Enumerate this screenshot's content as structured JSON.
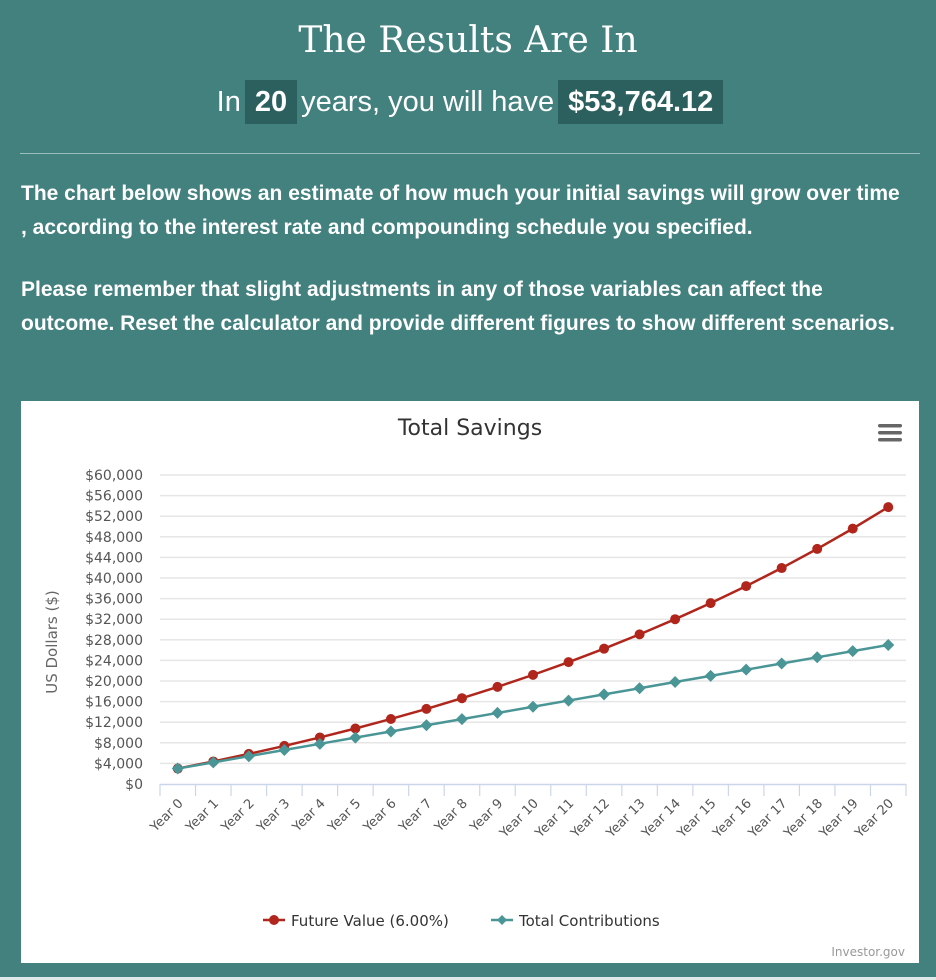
{
  "header": {
    "title": "The Results Are In",
    "prefix": "In",
    "years": "20",
    "middle": "years, you will have",
    "amount": "$53,764.12"
  },
  "body": {
    "paragraph1": "The chart below shows an estimate of how much your initial savings will grow over time , according to the interest rate and compounding schedule you specified.",
    "paragraph2": "Please remember that slight adjustments in any of those variables can affect the outcome. Reset the calculator and provide different figures to show different scenarios."
  },
  "chart_menu_icon": "hamburger-menu-icon",
  "credits": "Investor.gov",
  "colors": {
    "background": "#43817f",
    "highlight": "#2c605e",
    "future_value": "#b0261c",
    "contributions": "#4a9595"
  },
  "chart_data": {
    "type": "line",
    "title": "Total Savings",
    "xlabel": "",
    "ylabel": "US Dollars ($)",
    "ylim": [
      0,
      60000
    ],
    "ytick_step": 4000,
    "yticks": [
      "$0",
      "$4,000",
      "$8,000",
      "$12,000",
      "$16,000",
      "$20,000",
      "$24,000",
      "$28,000",
      "$32,000",
      "$36,000",
      "$40,000",
      "$44,000",
      "$48,000",
      "$52,000",
      "$56,000",
      "$60,000"
    ],
    "grid": true,
    "legend": "bottom-center",
    "categories": [
      "Year 0",
      "Year 1",
      "Year 2",
      "Year 3",
      "Year 4",
      "Year 5",
      "Year 6",
      "Year 7",
      "Year 8",
      "Year 9",
      "Year 10",
      "Year 11",
      "Year 12",
      "Year 13",
      "Year 14",
      "Year 15",
      "Year 16",
      "Year 17",
      "Year 18",
      "Year 19",
      "Year 20"
    ],
    "series": [
      {
        "name": "Future Value (6.00%)",
        "color": "#b0261c",
        "marker": "circle",
        "values": [
          3000,
          4380,
          5842.8,
          7393.37,
          9036.97,
          10779.19,
          12625.94,
          14583.5,
          16658.51,
          18858.02,
          21189.5,
          23660.87,
          26280.52,
          29057.35,
          32000.79,
          35120.84,
          38428.09,
          41933.78,
          45649.8,
          49588.79,
          53764.12
        ]
      },
      {
        "name": "Total Contributions",
        "color": "#4a9595",
        "marker": "diamond",
        "values": [
          3000,
          4200,
          5400,
          6600,
          7800,
          9000,
          10200,
          11400,
          12600,
          13800,
          15000,
          16200,
          17400,
          18600,
          19800,
          21000,
          22200,
          23400,
          24600,
          25800,
          27000
        ]
      }
    ]
  }
}
